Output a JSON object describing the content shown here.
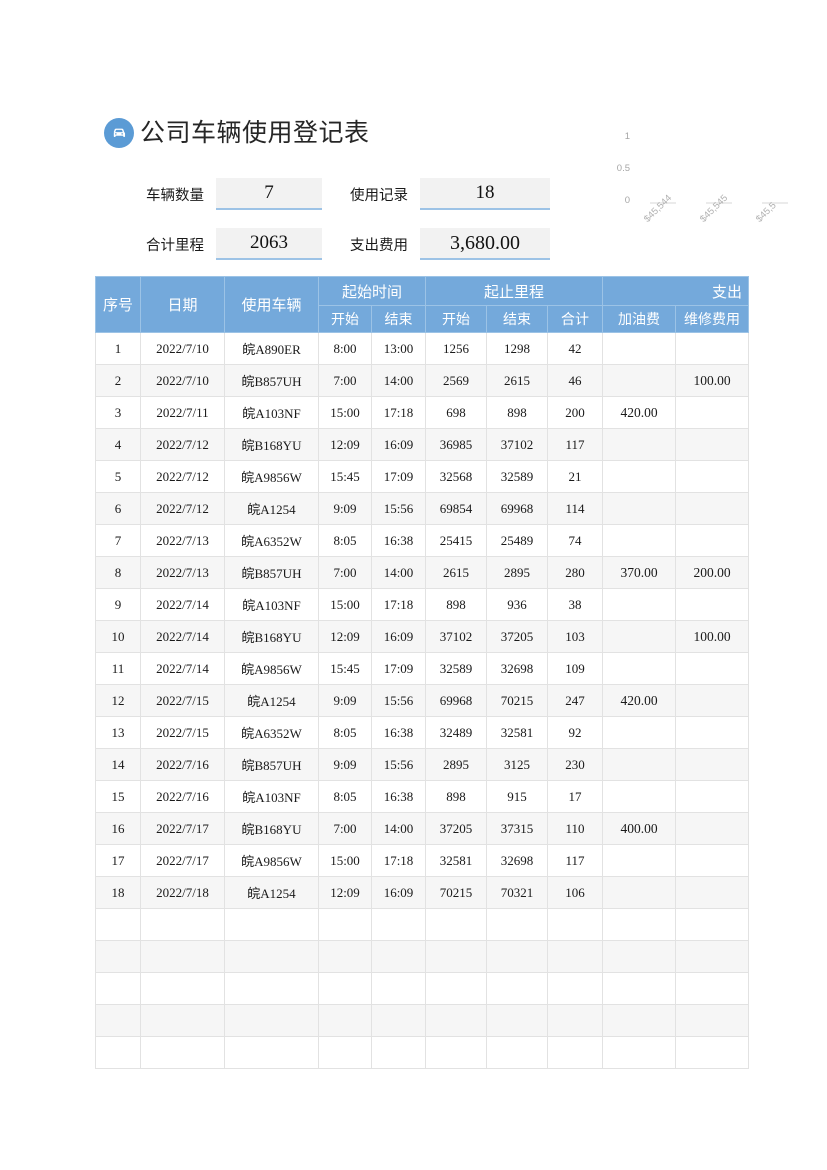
{
  "page": {
    "title": "公司车辆使用登记表",
    "title_icon": "car-icon"
  },
  "stats": [
    {
      "label": "车辆数量",
      "value": "7"
    },
    {
      "label": "使用记录",
      "value": "18"
    },
    {
      "label": "合计里程",
      "value": "2063"
    },
    {
      "label": "支出费用",
      "value": "3,680.00"
    }
  ],
  "theme": {
    "header_blue": "#74A9DB",
    "badge_blue": "#5B9BD5",
    "stat_fill": "#F2F2F2",
    "stat_underline": "#9DC3E6",
    "row_alt": "#F6F6F6",
    "grid_line": "#E2E2E2"
  },
  "chart_data": {
    "type": "bar",
    "title": "",
    "xlabel": "",
    "ylabel": "",
    "ylim": [
      0,
      1
    ],
    "yticks": [
      "0",
      "0.5",
      "1"
    ],
    "categories": [
      "$45,544",
      "$45,545",
      "$45,5"
    ],
    "values": [
      0,
      0,
      0
    ],
    "grid": false,
    "legend": "none",
    "note": "chart is clipped by the right edge of the page; third category label is cut off"
  },
  "table": {
    "group_headers": [
      {
        "label": "序号",
        "rowspan": 2,
        "colspan": 1
      },
      {
        "label": "日期",
        "rowspan": 2,
        "colspan": 1
      },
      {
        "label": "使用车辆",
        "rowspan": 2,
        "colspan": 1
      },
      {
        "label": "起始时间",
        "rowspan": 1,
        "colspan": 2
      },
      {
        "label": "起止里程",
        "rowspan": 1,
        "colspan": 3
      },
      {
        "label": "支出",
        "rowspan": 1,
        "colspan": 2,
        "align": "right"
      }
    ],
    "sub_headers": [
      "开始",
      "结束",
      "开始",
      "结束",
      "合计",
      "加油费",
      "维修费用"
    ],
    "rows": [
      {
        "no": "1",
        "date": "2022/7/10",
        "vehicle": "皖A890ER",
        "t_start": "8:00",
        "t_end": "13:00",
        "m_start": "1256",
        "m_end": "1298",
        "m_total": "42",
        "fuel": "",
        "repair": ""
      },
      {
        "no": "2",
        "date": "2022/7/10",
        "vehicle": "皖B857UH",
        "t_start": "7:00",
        "t_end": "14:00",
        "m_start": "2569",
        "m_end": "2615",
        "m_total": "46",
        "fuel": "",
        "repair": "100.00"
      },
      {
        "no": "3",
        "date": "2022/7/11",
        "vehicle": "皖A103NF",
        "t_start": "15:00",
        "t_end": "17:18",
        "m_start": "698",
        "m_end": "898",
        "m_total": "200",
        "fuel": "420.00",
        "repair": ""
      },
      {
        "no": "4",
        "date": "2022/7/12",
        "vehicle": "皖B168YU",
        "t_start": "12:09",
        "t_end": "16:09",
        "m_start": "36985",
        "m_end": "37102",
        "m_total": "117",
        "fuel": "",
        "repair": ""
      },
      {
        "no": "5",
        "date": "2022/7/12",
        "vehicle": "皖A9856W",
        "t_start": "15:45",
        "t_end": "17:09",
        "m_start": "32568",
        "m_end": "32589",
        "m_total": "21",
        "fuel": "",
        "repair": ""
      },
      {
        "no": "6",
        "date": "2022/7/12",
        "vehicle": "皖A1254",
        "t_start": "9:09",
        "t_end": "15:56",
        "m_start": "69854",
        "m_end": "69968",
        "m_total": "114",
        "fuel": "",
        "repair": ""
      },
      {
        "no": "7",
        "date": "2022/7/13",
        "vehicle": "皖A6352W",
        "t_start": "8:05",
        "t_end": "16:38",
        "m_start": "25415",
        "m_end": "25489",
        "m_total": "74",
        "fuel": "",
        "repair": ""
      },
      {
        "no": "8",
        "date": "2022/7/13",
        "vehicle": "皖B857UH",
        "t_start": "7:00",
        "t_end": "14:00",
        "m_start": "2615",
        "m_end": "2895",
        "m_total": "280",
        "fuel": "370.00",
        "repair": "200.00"
      },
      {
        "no": "9",
        "date": "2022/7/14",
        "vehicle": "皖A103NF",
        "t_start": "15:00",
        "t_end": "17:18",
        "m_start": "898",
        "m_end": "936",
        "m_total": "38",
        "fuel": "",
        "repair": ""
      },
      {
        "no": "10",
        "date": "2022/7/14",
        "vehicle": "皖B168YU",
        "t_start": "12:09",
        "t_end": "16:09",
        "m_start": "37102",
        "m_end": "37205",
        "m_total": "103",
        "fuel": "",
        "repair": "100.00"
      },
      {
        "no": "11",
        "date": "2022/7/14",
        "vehicle": "皖A9856W",
        "t_start": "15:45",
        "t_end": "17:09",
        "m_start": "32589",
        "m_end": "32698",
        "m_total": "109",
        "fuel": "",
        "repair": ""
      },
      {
        "no": "12",
        "date": "2022/7/15",
        "vehicle": "皖A1254",
        "t_start": "9:09",
        "t_end": "15:56",
        "m_start": "69968",
        "m_end": "70215",
        "m_total": "247",
        "fuel": "420.00",
        "repair": ""
      },
      {
        "no": "13",
        "date": "2022/7/15",
        "vehicle": "皖A6352W",
        "t_start": "8:05",
        "t_end": "16:38",
        "m_start": "32489",
        "m_end": "32581",
        "m_total": "92",
        "fuel": "",
        "repair": ""
      },
      {
        "no": "14",
        "date": "2022/7/16",
        "vehicle": "皖B857UH",
        "t_start": "9:09",
        "t_end": "15:56",
        "m_start": "2895",
        "m_end": "3125",
        "m_total": "230",
        "fuel": "",
        "repair": ""
      },
      {
        "no": "15",
        "date": "2022/7/16",
        "vehicle": "皖A103NF",
        "t_start": "8:05",
        "t_end": "16:38",
        "m_start": "898",
        "m_end": "915",
        "m_total": "17",
        "fuel": "",
        "repair": ""
      },
      {
        "no": "16",
        "date": "2022/7/17",
        "vehicle": "皖B168YU",
        "t_start": "7:00",
        "t_end": "14:00",
        "m_start": "37205",
        "m_end": "37315",
        "m_total": "110",
        "fuel": "400.00",
        "repair": ""
      },
      {
        "no": "17",
        "date": "2022/7/17",
        "vehicle": "皖A9856W",
        "t_start": "15:00",
        "t_end": "17:18",
        "m_start": "32581",
        "m_end": "32698",
        "m_total": "117",
        "fuel": "",
        "repair": ""
      },
      {
        "no": "18",
        "date": "2022/7/18",
        "vehicle": "皖A1254",
        "t_start": "12:09",
        "t_end": "16:09",
        "m_start": "70215",
        "m_end": "70321",
        "m_total": "106",
        "fuel": "",
        "repair": ""
      },
      {
        "no": "",
        "date": "",
        "vehicle": "",
        "t_start": "",
        "t_end": "",
        "m_start": "",
        "m_end": "",
        "m_total": "",
        "fuel": "",
        "repair": ""
      },
      {
        "no": "",
        "date": "",
        "vehicle": "",
        "t_start": "",
        "t_end": "",
        "m_start": "",
        "m_end": "",
        "m_total": "",
        "fuel": "",
        "repair": ""
      },
      {
        "no": "",
        "date": "",
        "vehicle": "",
        "t_start": "",
        "t_end": "",
        "m_start": "",
        "m_end": "",
        "m_total": "",
        "fuel": "",
        "repair": ""
      },
      {
        "no": "",
        "date": "",
        "vehicle": "",
        "t_start": "",
        "t_end": "",
        "m_start": "",
        "m_end": "",
        "m_total": "",
        "fuel": "",
        "repair": ""
      },
      {
        "no": "",
        "date": "",
        "vehicle": "",
        "t_start": "",
        "t_end": "",
        "m_start": "",
        "m_end": "",
        "m_total": "",
        "fuel": "",
        "repair": ""
      }
    ]
  }
}
